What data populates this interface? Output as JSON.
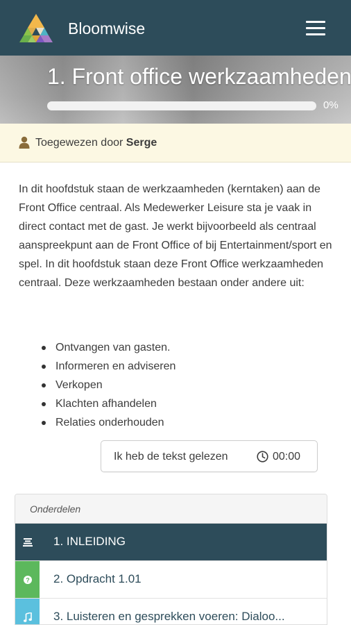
{
  "app": {
    "brand": "Bloomwise"
  },
  "icons": {
    "logo": "triangle-logo-icon",
    "menu": "hamburger-menu-icon",
    "user": "user-icon",
    "clock": "clock-icon"
  },
  "colors": {
    "navbar": "#2d4c5a",
    "assigned_bg": "#fcf8e3",
    "active_row": "#2d4c5a",
    "quiz_icon": "#5cb85c",
    "audio_icon": "#5bc0de"
  },
  "chapter": {
    "title": "1. Front office werkzaamheden",
    "progress_percent": 0,
    "progress_label": "0%"
  },
  "assigned": {
    "prefix": "Toegewezen door",
    "name": "Serge"
  },
  "content": {
    "paragraph": "In dit hoofdstuk staan de werkzaamheden (kerntaken) aan de Front Office centraal. Als Medewerker Leisure sta je vaak in direct contact met de gast. Je werkt bijvoorbeeld als centraal aanspreekpunt aan de Front Office of bij Entertainment/sport en spel. In dit hoofdstuk staan deze Front Office werkzaamheden centraal. Deze werkzaamheden bestaan onder andere uit:",
    "bullets": [
      "Ontvangen van gasten.",
      "Informeren en adviseren",
      "Verkopen",
      "Klachten afhandelen",
      "Relaties onderhouden"
    ]
  },
  "read_button": {
    "label": "Ik heb de tekst gelezen",
    "timer": "00:00"
  },
  "sections": {
    "heading": "Onderdelen",
    "items": [
      {
        "label": "1. INLEIDING",
        "icon": "text-lines-icon"
      },
      {
        "label": "2. Opdracht 1.01",
        "icon": "question-circle-icon"
      },
      {
        "label": "3. Luisteren en gesprekken voeren: Dialoo...",
        "icon": "music-note-icon"
      }
    ]
  }
}
